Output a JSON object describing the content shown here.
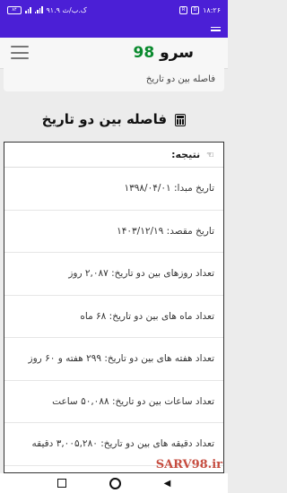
{
  "status_bar": {
    "time": "۱۸:۲۶",
    "network_speed": "۹۱.۹ ک.ب/ث",
    "battery": "۸۴"
  },
  "header": {
    "logo_text": "سرو",
    "logo_number": "98"
  },
  "breadcrumb": {
    "text": "فاصله بین دو تاریخ"
  },
  "page": {
    "title": "فاصله بین دو تاریخ"
  },
  "result": {
    "heading": "نتیجه:",
    "rows": [
      "تاریخ مبدا: ۱۳۹۸/۰۴/۰۱",
      "تاریخ مقصد: ۱۴۰۳/۱۲/۱۹",
      "تعداد روزهای بین دو تاریخ: ۲,۰۸۷ روز",
      "تعداد ماه های بین دو تاریخ: ۶۸ ماه",
      "تعداد هفته های بین دو تاریخ: ۲۹۹ هفته و ۶۰ روز",
      "تعداد ساعات بین دو تاریخ: ۵۰,۰۸۸ ساعت",
      "تعداد دقیقه های بین دو تاریخ: ۳,۰۰۵,۲۸۰ دقیقه"
    ]
  },
  "watermark": "SARV98.ir",
  "colors": {
    "accent": "#4b1fd6",
    "logo_number": "#0a8a2e"
  }
}
